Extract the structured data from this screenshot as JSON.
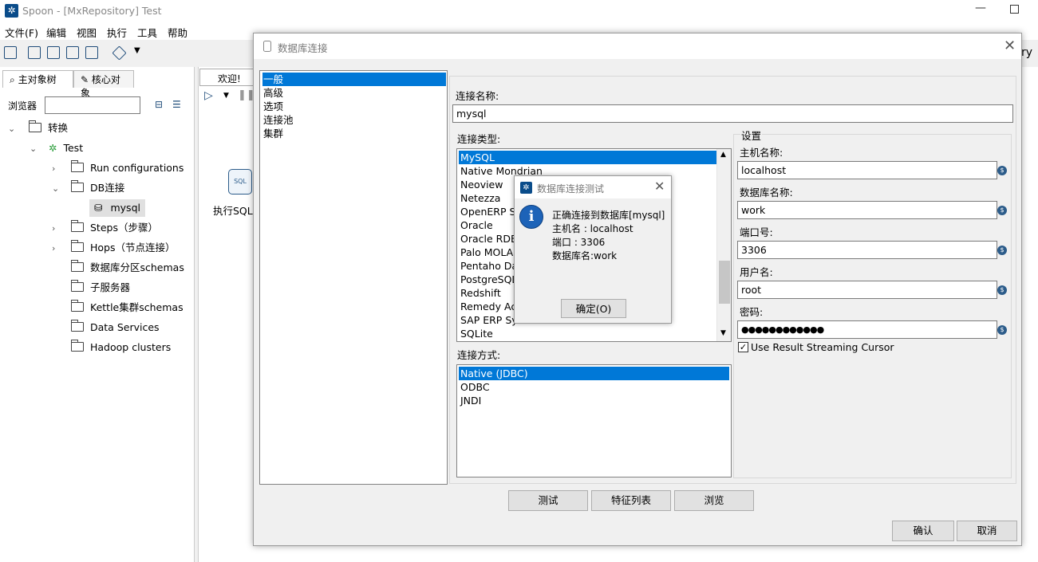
{
  "window": {
    "title": "Spoon - [MxRepository] Test"
  },
  "menu": [
    "文件(F)",
    "编辑",
    "视图",
    "执行",
    "工具",
    "帮助"
  ],
  "left_panel": {
    "tabs": [
      "主对象树",
      "核心对象"
    ],
    "browser_label": "浏览器",
    "tree": {
      "root": "转换",
      "transformation": "Test",
      "items": [
        "Run configurations",
        "DB连接",
        "mysql",
        "Steps（步骤）",
        "Hops（节点连接）",
        "数据库分区schemas",
        "子服务器",
        "Kettle集群schemas",
        "Data Services",
        "Hadoop clusters"
      ]
    }
  },
  "right_area": {
    "welcome_tab": "欢迎!",
    "exec_sql_label": "执行SQL脚本",
    "exec_sql_icon_text": "SQL",
    "background_text": "ry"
  },
  "db_dialog": {
    "title": "数据库连接",
    "nav": [
      "一般",
      "高级",
      "选项",
      "连接池",
      "集群"
    ],
    "conn_name_label": "连接名称:",
    "conn_name_value": "mysql",
    "conn_type_label": "连接类型:",
    "conn_types": [
      "MySQL",
      "Native Mondrian",
      "Neoview",
      "Netezza",
      "OpenERP Server",
      "Oracle",
      "Oracle RDB",
      "Palo MOLAP Server",
      "Pentaho Data Services",
      "PostgreSQL",
      "Redshift",
      "Remedy Action Request System",
      "SAP ERP System",
      "SQLite"
    ],
    "conn_method_label": "连接方式:",
    "conn_methods": [
      "Native (JDBC)",
      "ODBC",
      "JNDI"
    ],
    "settings": {
      "title": "设置",
      "host_label": "主机名称:",
      "host_value": "localhost",
      "dbname_label": "数据库名称:",
      "dbname_value": "work",
      "port_label": "端口号:",
      "port_value": "3306",
      "user_label": "用户名:",
      "user_value": "root",
      "password_label": "密码:",
      "password_value": "●●●●●●●●●●●●",
      "stream_cursor_label": "Use Result Streaming Cursor",
      "stream_cursor_checked": true
    },
    "buttons": {
      "test": "测试",
      "features": "特征列表",
      "explore": "浏览",
      "ok": "确认",
      "cancel": "取消"
    }
  },
  "test_dialog": {
    "title": "数据库连接测试",
    "lines": [
      "正确连接到数据库[mysql]",
      "主机名      : localhost",
      "端口         : 3306",
      "数据库名:work"
    ],
    "ok_button": "确定(O)"
  }
}
